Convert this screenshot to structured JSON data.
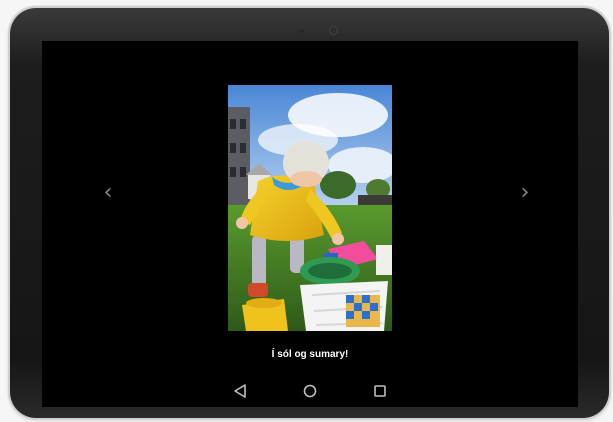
{
  "gallery": {
    "caption": "Í sól og sumary!",
    "photo_alt": "Toddler in yellow raincoat and knit hat playing with colorful plastic toys on grass",
    "prev_icon": "chevron-left-icon",
    "next_icon": "chevron-right-icon",
    "prev_glyph": "‹",
    "next_glyph": "›"
  },
  "system_nav": {
    "back_icon": "back-triangle-icon",
    "home_icon": "home-circle-icon",
    "recents_icon": "recents-square-icon"
  },
  "colors": {
    "screen_background": "#000000",
    "bezel": "#1a1a1a",
    "nav_icons": "#bfbfbf",
    "caption_text": "#ffffff"
  }
}
